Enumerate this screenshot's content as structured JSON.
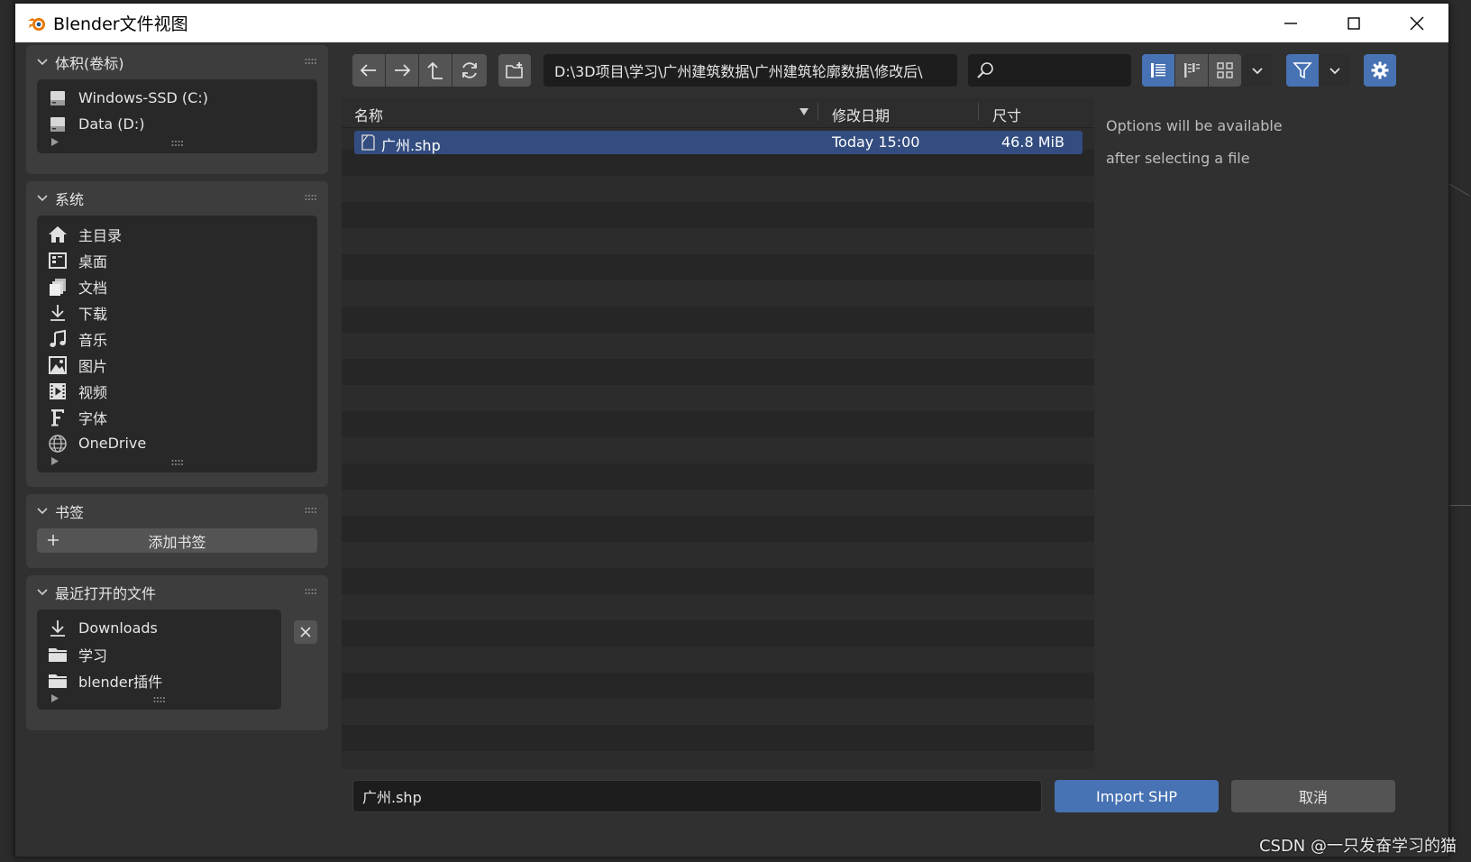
{
  "window": {
    "title": "Blender文件视图"
  },
  "sidebar": {
    "volumes": {
      "title": "体积(卷标)",
      "items": [
        {
          "label": "Windows-SSD (C:)",
          "icon": "drive-icon"
        },
        {
          "label": "Data (D:)",
          "icon": "drive-icon"
        }
      ]
    },
    "system": {
      "title": "系统",
      "items": [
        {
          "label": "主目录",
          "icon": "home-icon"
        },
        {
          "label": "桌面",
          "icon": "desktop-icon"
        },
        {
          "label": "文档",
          "icon": "documents-icon"
        },
        {
          "label": "下载",
          "icon": "download-icon"
        },
        {
          "label": "音乐",
          "icon": "music-icon"
        },
        {
          "label": "图片",
          "icon": "image-icon"
        },
        {
          "label": "视频",
          "icon": "video-icon"
        },
        {
          "label": "字体",
          "icon": "font-icon"
        },
        {
          "label": "OneDrive",
          "icon": "globe-icon"
        }
      ]
    },
    "bookmarks": {
      "title": "书签",
      "add_label": "添加书签"
    },
    "recent": {
      "title": "最近打开的文件",
      "items": [
        {
          "label": "Downloads",
          "icon": "download-icon"
        },
        {
          "label": "学习",
          "icon": "folder-icon"
        },
        {
          "label": "blender插件",
          "icon": "folder-icon"
        }
      ]
    }
  },
  "toolbar": {
    "path": "D:\\3D项目\\学习\\广州建筑数据\\广州建筑轮廓数据\\修改后\\",
    "search_placeholder": ""
  },
  "filelist": {
    "columns": {
      "name": "名称",
      "date": "修改日期",
      "size": "尺寸"
    },
    "files": [
      {
        "name": "广州.shp",
        "date": "Today 15:00",
        "size": "46.8 MiB",
        "selected": true
      }
    ]
  },
  "options": {
    "line1": "Options will be available",
    "line2": "after selecting a file"
  },
  "bottom": {
    "filename": "广州.shp",
    "import_label": "Import SHP",
    "cancel_label": "取消"
  },
  "watermark": "CSDN @一只发奋学习的猫",
  "colors": {
    "accent": "#4772b3",
    "selection": "#334d80",
    "panel": "#3d3d3d",
    "background": "#303030"
  }
}
